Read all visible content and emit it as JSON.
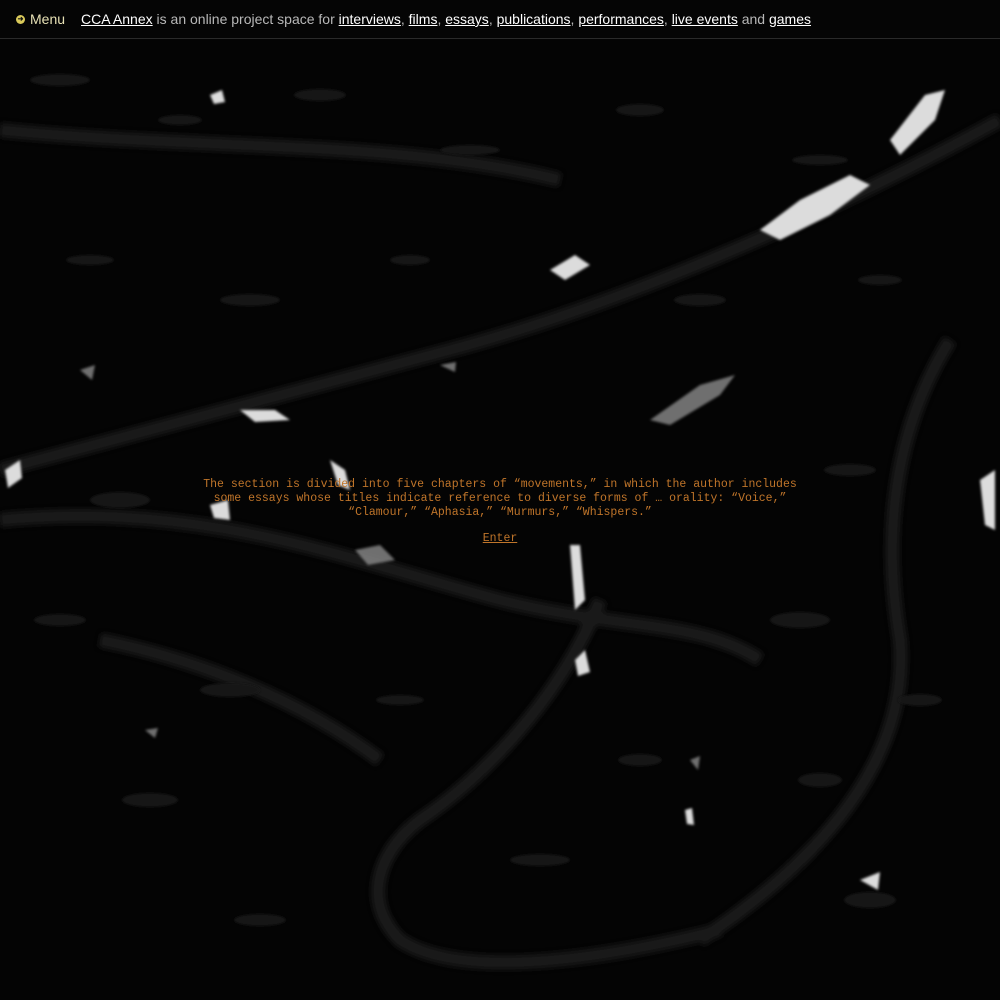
{
  "header": {
    "menu_label": "Menu",
    "menu_icon": "arrow-right-circle-icon",
    "accent_color": "#d9c95a",
    "brand_link": "CCA Annex",
    "description_prefix": "is an online project space for",
    "links": [
      "interviews",
      "films",
      "essays",
      "publications",
      "performances",
      "live events",
      "games"
    ],
    "separator": ",",
    "conjunction": "and"
  },
  "intro": {
    "text": "The section is divided into five chapters of “movements,” in which the author includes some essays whose titles indicate reference to diverse forms of … orality: “Voice,” “Clamour,” “Aphasia,” “Murmurs,” “Whispers.”",
    "enter_label": "Enter",
    "text_color": "#c0752a"
  }
}
